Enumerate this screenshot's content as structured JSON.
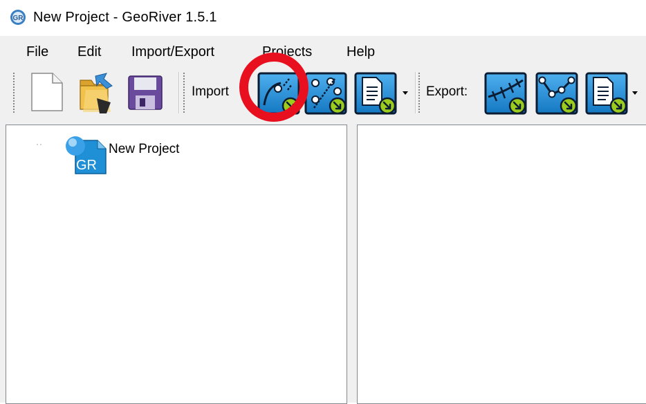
{
  "window": {
    "title": "New Project - GeoRiver 1.5.1",
    "app_icon_text": "GR"
  },
  "menu": [
    "File",
    "Edit",
    "Import/Export",
    "Projects",
    "Help"
  ],
  "toolbar": {
    "import_label": "Import",
    "export_label": "Export:"
  },
  "tree": {
    "expander": "··",
    "root_label": "New Project",
    "root_icon_text": "GR"
  },
  "annotation": {
    "color": "#e8101e"
  },
  "colors": {
    "toolbar_bg": "#f0f0f0",
    "button_blue": "#1e88cf",
    "button_border": "#0b1c33",
    "badge_green": "#9ccc1c",
    "folder_yellow": "#f0c24c",
    "disk_purple": "#6a4a9c"
  },
  "icons": {
    "new": "new-document-icon",
    "open": "open-folder-icon",
    "save": "save-disk-icon",
    "import_polyline": "import-polyline-icon",
    "import_points": "import-points-icon",
    "import_file": "import-file-icon",
    "export_cross_sections": "export-cross-sections-icon",
    "export_polyline": "export-polyline-icon",
    "export_file": "export-file-icon"
  }
}
